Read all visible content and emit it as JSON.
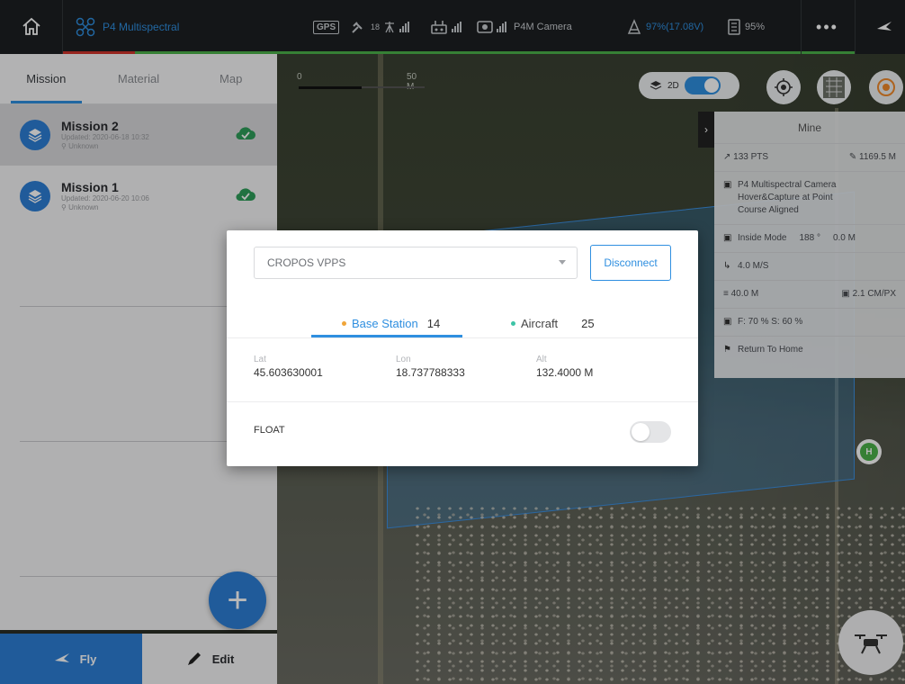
{
  "topbar": {
    "aircraft_name": "P4 Multispectral",
    "gps_label": "GPS",
    "satellite_count": "18",
    "camera_label": "P4M Camera",
    "battery_text": "97%(17.08V)",
    "storage_text": "95%",
    "more_label": "•••"
  },
  "left_panel": {
    "tabs": [
      {
        "label": "Mission"
      },
      {
        "label": "Material"
      },
      {
        "label": "Map"
      }
    ],
    "missions": [
      {
        "title": "Mission 2",
        "updated": "Updated: 2020-06-18 10:32",
        "location": "Unknown"
      },
      {
        "title": "Mission 1",
        "updated": "Updated: 2020-06-20 10:06",
        "location": "Unknown"
      }
    ],
    "add_label": "+",
    "fly_label": "Fly",
    "edit_label": "Edit"
  },
  "map": {
    "scale_start": "0",
    "scale_end": "50 M",
    "view_mode": "2D"
  },
  "info_panel": {
    "title": "Mine",
    "points": "133 PTS",
    "distance": "1169.5 M",
    "camera": "P4 Multispectral Camera",
    "capture": "Hover&Capture at Point",
    "course": "Course Aligned",
    "mode": "Inside Mode",
    "angle": "188 °",
    "offset": "0.0 M",
    "speed": "4.0 M/S",
    "altitude": "40.0 M",
    "gsd": "2.1 CM/PX",
    "overlap": "F: 70 %  S: 60 %",
    "finish_action": "Return To Home"
  },
  "dialog": {
    "service_value": "CROPOS VPPS",
    "disconnect_label": "Disconnect",
    "tabs": [
      {
        "label": "Base Station",
        "count": "14",
        "dot_color": "#f0a53a"
      },
      {
        "label": "Aircraft",
        "count": "25",
        "dot_color": "#3cc3a6"
      }
    ],
    "lat_label": "Lat",
    "lat_value": "45.603630001",
    "lon_label": "Lon",
    "lon_value": "18.737788333",
    "alt_label": "Alt",
    "alt_value": "132.4000 M",
    "status_label": "FLOAT"
  },
  "colors": {
    "accent": "#2f8fe0",
    "signal_ok": "#4bb24a",
    "warning": "#d0342c"
  }
}
